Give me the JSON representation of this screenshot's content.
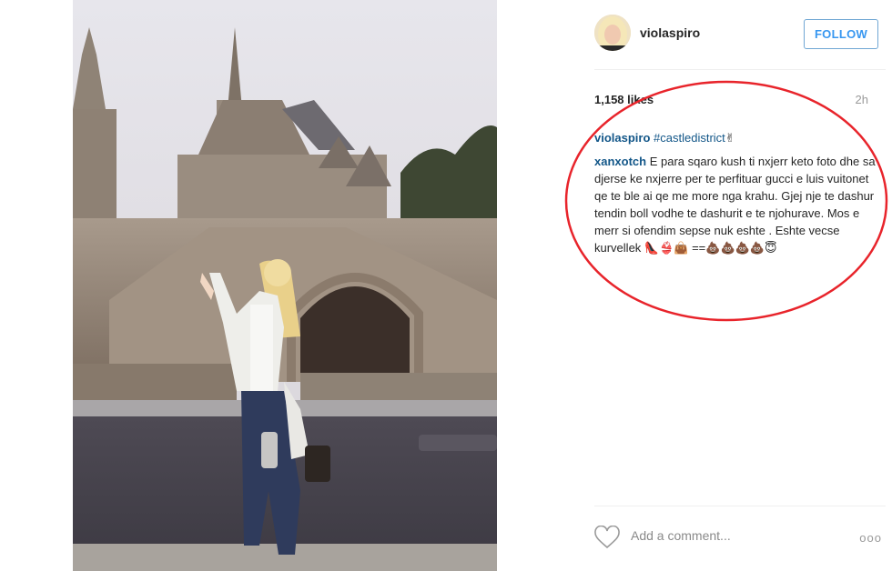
{
  "post": {
    "username": "violaspiro",
    "follow_label": "FOLLOW",
    "likes": "1,158 likes",
    "time": "2h",
    "caption_user": "violaspiro",
    "caption_hashtag": "#castledistrict",
    "caption_emoji": "✌",
    "comment_user": "xanxotch",
    "comment_text": "E para sqaro kush ti nxjerr keto foto dhe sa djerse ke nxjerre per te perfituar gucci e luis vuitonet qe te ble ai qe me more nga krahu. Gjej nje te dashur tendin boll vodhe te dashurit e te njohurave. Mos e merr si ofendim sepse nuk eshte . Eshte vecse kurvellek 👠👙👜 ==💩💩💩💩😇",
    "add_comment_placeholder": "Add a comment...",
    "more_label": "ooo"
  },
  "icons": {
    "like": "heart-outline-icon",
    "more": "more-options-icon"
  },
  "colors": {
    "follow_border": "#70a7d4",
    "follow_text": "#3897f0",
    "link": "#125688",
    "annotation_circle": "#e8242b"
  }
}
